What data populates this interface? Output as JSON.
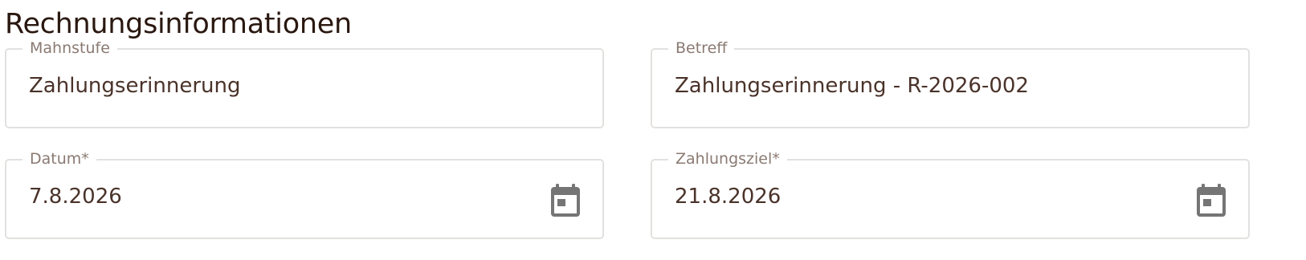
{
  "section": {
    "title": "Rechnungsinformationen"
  },
  "fields": {
    "mahnstufe": {
      "label": "Mahnstufe",
      "value": "Zahlungserinnerung"
    },
    "betreff": {
      "label": "Betreff",
      "value": "Zahlungserinnerung - R-2026-002"
    },
    "datum": {
      "label": "Datum*",
      "value": "7.8.2026",
      "icon": "calendar-icon"
    },
    "zahlungsziel": {
      "label": "Zahlungsziel*",
      "value": "21.8.2026",
      "icon": "calendar-icon"
    }
  },
  "colors": {
    "text": "#4a332a",
    "title": "#2a1810",
    "label": "#8a7a72",
    "border": "#e3e1df",
    "icon": "#757575"
  }
}
